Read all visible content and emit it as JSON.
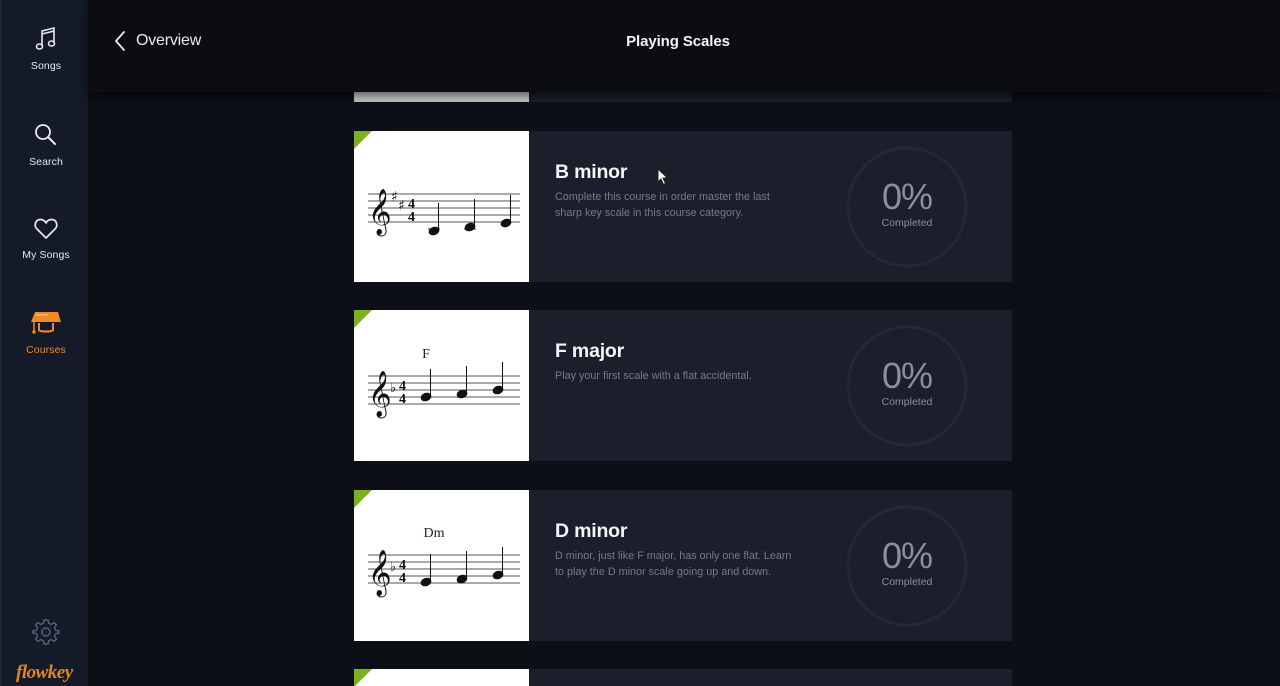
{
  "sidebar": {
    "items": [
      {
        "label": "Songs",
        "icon": "music-note-icon",
        "active": false
      },
      {
        "label": "Search",
        "icon": "search-icon",
        "active": false
      },
      {
        "label": "My Songs",
        "icon": "heart-icon",
        "active": false
      },
      {
        "label": "Courses",
        "icon": "graduation-cap-icon",
        "active": true
      }
    ],
    "settings_icon": "gear-icon",
    "logo_text": "flowkey"
  },
  "header": {
    "back_label": "Overview",
    "title": "Playing Scales"
  },
  "colors": {
    "accent": "#f08a24",
    "completed_corner": "#7bb01f",
    "card_bg": "#1a1f2b",
    "sidebar_bg": "#141a27"
  },
  "courses": [
    {
      "title": "B minor",
      "description": "Complete this course in order master the last sharp key scale in this course category.",
      "chord_label": "",
      "key_signature": "2 sharps",
      "progress_percent": 0,
      "progress_text": "0%",
      "progress_label": "Completed"
    },
    {
      "title": "F major",
      "description": "Play your first scale with a flat accidental.",
      "chord_label": "F",
      "key_signature": "1 flat",
      "progress_percent": 0,
      "progress_text": "0%",
      "progress_label": "Completed"
    },
    {
      "title": "D minor",
      "description": "D minor, just like F major, has only one flat. Learn to play the D minor scale going up and down.",
      "chord_label": "Dm",
      "key_signature": "1 flat",
      "progress_percent": 0,
      "progress_text": "0%",
      "progress_label": "Completed"
    }
  ]
}
